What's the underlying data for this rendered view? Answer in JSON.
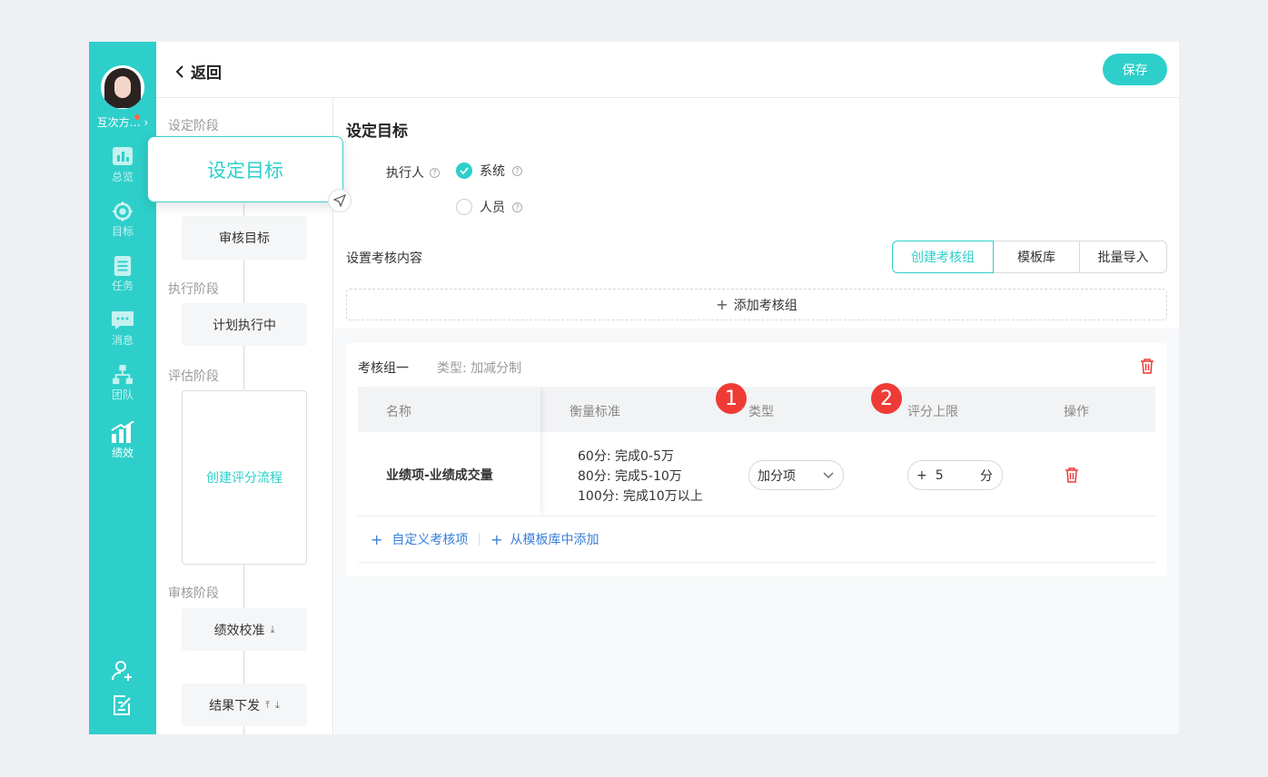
{
  "nav": {
    "user_name": "互次方…",
    "items": [
      {
        "label": "总览",
        "icon": "chart-bar-icon"
      },
      {
        "label": "目标",
        "icon": "target-icon"
      },
      {
        "label": "任务",
        "icon": "task-list-icon"
      },
      {
        "label": "消息",
        "icon": "message-icon"
      },
      {
        "label": "团队",
        "icon": "team-icon"
      },
      {
        "label": "绩效",
        "icon": "performance-icon"
      }
    ],
    "active": "绩效"
  },
  "header": {
    "back_label": "返回",
    "save_label": "保存"
  },
  "steps": {
    "stage_setup": "设定阶段",
    "popup_label": "设定目标",
    "review_target": "审核目标",
    "stage_exec": "执行阶段",
    "plan_exec": "计划执行中",
    "stage_eval": "评估阶段",
    "create_flow": "创建评分流程",
    "stage_audit": "审核阶段",
    "calibration": "绩效校准",
    "result_issue": "结果下发"
  },
  "main": {
    "title": "设定目标",
    "executor_label": "执行人",
    "option_system": "系统",
    "option_person": "人员",
    "content_label": "设置考核内容",
    "tabs": [
      "创建考核组",
      "模板库",
      "批量导入"
    ],
    "add_group": "添加考核组"
  },
  "group": {
    "title": "考核组一",
    "type_text": "类型: 加减分制",
    "columns": [
      "名称",
      "衡量标准",
      "类型",
      "评分上限",
      "操作"
    ],
    "rows": [
      {
        "name": "业绩项-业绩成交量",
        "criteria": [
          "60分: 完成0-5万",
          "80分: 完成5-10万",
          "100分: 完成10万以上"
        ],
        "type": "加分项",
        "limit_sign": "+",
        "limit_value": "5",
        "limit_unit": "分"
      }
    ],
    "custom_link": "自定义考核项",
    "template_link": "从模板库中添加"
  },
  "badges": [
    "1",
    "2"
  ],
  "colors": {
    "accent": "#2ecfca",
    "danger": "#ef3b36",
    "link": "#3a7ed8"
  }
}
